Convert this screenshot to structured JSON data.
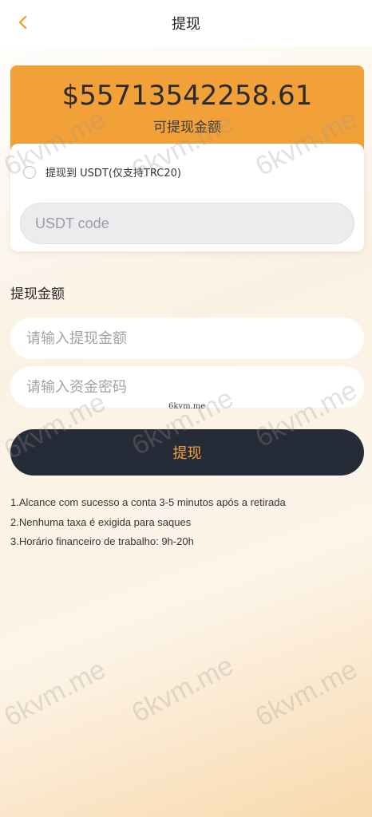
{
  "header": {
    "title": "提现",
    "back_icon": "chevron-left-icon",
    "accent_color": "#f2a038"
  },
  "balance": {
    "amount": "$55713542258.61",
    "label": "可提现金额",
    "card_color": "#f2a038"
  },
  "usdt": {
    "option_label": "提现到 USDT(仅支持TRC20)",
    "selected": false,
    "input_placeholder": "USDT code",
    "input_value": ""
  },
  "withdraw_form": {
    "section_label": "提现金额",
    "amount_placeholder": "请输入提现金额",
    "password_placeholder": "请输入资金密码",
    "submit_label": "提现",
    "button_color": "#262b38"
  },
  "notes": [
    "1.Alcance com sucesso a conta 3-5 minutos após a retirada",
    "2.Nenhuma taxa é exigida para saques",
    "3.Horário financeiro de trabalho: 9h-20h"
  ],
  "watermark": {
    "text": "6kvm.me",
    "small_text": "6kvm.me"
  }
}
